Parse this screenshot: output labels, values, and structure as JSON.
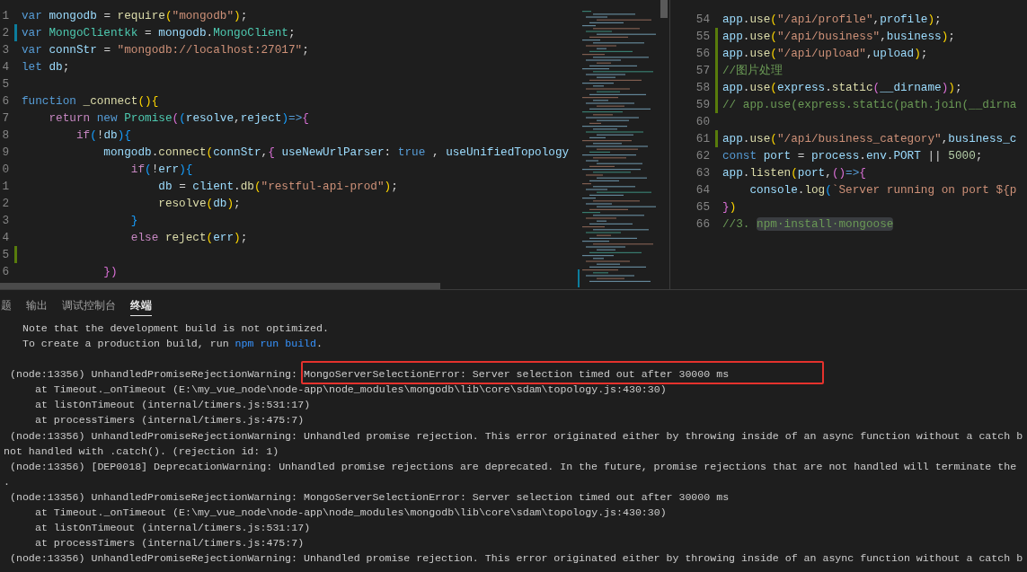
{
  "left_editor": {
    "lines": [
      {
        "number": "1",
        "tokens": [
          {
            "kind": "kw",
            "text": "var"
          },
          {
            "kind": "id",
            "text": " mongodb"
          },
          {
            "kind": "p",
            "text": " = "
          },
          {
            "kind": "fn",
            "text": "require"
          },
          {
            "kind": "b1",
            "text": "("
          },
          {
            "kind": "str",
            "text": "\"mongodb\""
          },
          {
            "kind": "b1",
            "text": ")"
          },
          {
            "kind": "p",
            "text": ";"
          }
        ]
      },
      {
        "number": "2",
        "change_marker": {
          "color": "#0c7d9d"
        },
        "tokens": [
          {
            "kind": "kw",
            "text": "var"
          },
          {
            "kind": "cls",
            "text": " MongoClientkk"
          },
          {
            "kind": "p",
            "text": " = "
          },
          {
            "kind": "id",
            "text": "mongodb"
          },
          {
            "kind": "p",
            "text": "."
          },
          {
            "kind": "cls",
            "text": "MongoClient"
          },
          {
            "kind": "p",
            "text": ";"
          }
        ]
      },
      {
        "number": "3",
        "tokens": [
          {
            "kind": "kw",
            "text": "var"
          },
          {
            "kind": "id",
            "text": " connStr"
          },
          {
            "kind": "p",
            "text": " = "
          },
          {
            "kind": "str",
            "text": "\"mongodb://localhost:27017\""
          },
          {
            "kind": "p",
            "text": ";"
          }
        ]
      },
      {
        "number": "4",
        "tokens": [
          {
            "kind": "kw",
            "text": "let"
          },
          {
            "kind": "id",
            "text": " db"
          },
          {
            "kind": "p",
            "text": ";"
          }
        ]
      },
      {
        "number": "5"
      },
      {
        "number": "6",
        "tokens": [
          {
            "kind": "kw",
            "text": "function"
          },
          {
            "kind": "fn",
            "text": " _connect"
          },
          {
            "kind": "b1",
            "text": "()"
          },
          {
            "kind": "b1",
            "text": "{"
          }
        ]
      },
      {
        "number": "7",
        "tokens": [
          {
            "kind": "ctl",
            "text": "    return"
          },
          {
            "kind": "kw",
            "text": " new"
          },
          {
            "kind": "cls",
            "text": " Promise"
          },
          {
            "kind": "b2",
            "text": "("
          },
          {
            "kind": "b3",
            "text": "("
          },
          {
            "kind": "id",
            "text": "resolve"
          },
          {
            "kind": "p",
            "text": ","
          },
          {
            "kind": "id",
            "text": "reject"
          },
          {
            "kind": "b3",
            "text": ")"
          },
          {
            "kind": "kw",
            "text": "=>"
          },
          {
            "kind": "b2",
            "text": "{"
          }
        ]
      },
      {
        "number": "8",
        "tokens": [
          {
            "kind": "ctl",
            "text": "        if"
          },
          {
            "kind": "b3",
            "text": "("
          },
          {
            "kind": "p",
            "text": "!"
          },
          {
            "kind": "id",
            "text": "db"
          },
          {
            "kind": "b3",
            "text": ")"
          },
          {
            "kind": "b3",
            "text": "{"
          }
        ]
      },
      {
        "number": "9",
        "tokens": [
          {
            "kind": "id",
            "text": "            mongodb"
          },
          {
            "kind": "p",
            "text": "."
          },
          {
            "kind": "fn",
            "text": "connect"
          },
          {
            "kind": "b1",
            "text": "("
          },
          {
            "kind": "id",
            "text": "connStr"
          },
          {
            "kind": "p",
            "text": ","
          },
          {
            "kind": "b2",
            "text": "{"
          },
          {
            "kind": "id",
            "text": " useNewUrlParser"
          },
          {
            "kind": "p",
            "text": ": "
          },
          {
            "kind": "kw",
            "text": "true"
          },
          {
            "kind": "p",
            "text": " , "
          },
          {
            "kind": "id",
            "text": "useUnifiedTopology"
          }
        ]
      },
      {
        "number": "0",
        "tokens": [
          {
            "kind": "ctl",
            "text": "                if"
          },
          {
            "kind": "b3",
            "text": "("
          },
          {
            "kind": "p",
            "text": "!"
          },
          {
            "kind": "id",
            "text": "err"
          },
          {
            "kind": "b3",
            "text": ")"
          },
          {
            "kind": "b3",
            "text": "{"
          }
        ]
      },
      {
        "number": "1",
        "tokens": [
          {
            "kind": "id",
            "text": "                    db"
          },
          {
            "kind": "p",
            "text": " = "
          },
          {
            "kind": "id",
            "text": "client"
          },
          {
            "kind": "p",
            "text": "."
          },
          {
            "kind": "fn",
            "text": "db"
          },
          {
            "kind": "b1",
            "text": "("
          },
          {
            "kind": "str",
            "text": "\"restful-api-prod\""
          },
          {
            "kind": "b1",
            "text": ")"
          },
          {
            "kind": "p",
            "text": ";"
          }
        ]
      },
      {
        "number": "2",
        "tokens": [
          {
            "kind": "fn",
            "text": "                    resolve"
          },
          {
            "kind": "b1",
            "text": "("
          },
          {
            "kind": "id",
            "text": "db"
          },
          {
            "kind": "b1",
            "text": ")"
          },
          {
            "kind": "p",
            "text": ";"
          }
        ]
      },
      {
        "number": "3",
        "tokens": [
          {
            "kind": "b3",
            "text": "                }"
          }
        ]
      },
      {
        "number": "4",
        "tokens": [
          {
            "kind": "ctl",
            "text": "                else"
          },
          {
            "kind": "fn",
            "text": " reject"
          },
          {
            "kind": "b1",
            "text": "("
          },
          {
            "kind": "id",
            "text": "err"
          },
          {
            "kind": "b1",
            "text": ")"
          },
          {
            "kind": "p",
            "text": ";"
          }
        ]
      },
      {
        "number": "5",
        "change_marker": {
          "color": "#587c0c"
        }
      },
      {
        "number": "6",
        "tokens": [
          {
            "kind": "b2",
            "text": "            })"
          }
        ]
      }
    ]
  },
  "right_editor": {
    "lines": [
      {
        "number": "54",
        "tokens": [
          {
            "kind": "id",
            "text": "app"
          },
          {
            "kind": "p",
            "text": "."
          },
          {
            "kind": "fn",
            "text": "use"
          },
          {
            "kind": "b1",
            "text": "("
          },
          {
            "kind": "str",
            "text": "\"/api/profile\""
          },
          {
            "kind": "p",
            "text": ","
          },
          {
            "kind": "id",
            "text": "profile"
          },
          {
            "kind": "b1",
            "text": ")"
          },
          {
            "kind": "p",
            "text": ";"
          }
        ]
      },
      {
        "number": "55",
        "change_marker": {
          "color": "#587c0c"
        },
        "tokens": [
          {
            "kind": "id",
            "text": "app"
          },
          {
            "kind": "p",
            "text": "."
          },
          {
            "kind": "fn",
            "text": "use"
          },
          {
            "kind": "b1",
            "text": "("
          },
          {
            "kind": "str",
            "text": "\"/api/business\""
          },
          {
            "kind": "p",
            "text": ","
          },
          {
            "kind": "id",
            "text": "business"
          },
          {
            "kind": "b1",
            "text": ")"
          },
          {
            "kind": "p",
            "text": ";"
          }
        ]
      },
      {
        "number": "56",
        "change_marker": {
          "color": "#587c0c"
        },
        "tokens": [
          {
            "kind": "id",
            "text": "app"
          },
          {
            "kind": "p",
            "text": "."
          },
          {
            "kind": "fn",
            "text": "use"
          },
          {
            "kind": "b1",
            "text": "("
          },
          {
            "kind": "str",
            "text": "\"/api/upload\""
          },
          {
            "kind": "p",
            "text": ","
          },
          {
            "kind": "id",
            "text": "upload"
          },
          {
            "kind": "b1",
            "text": ")"
          },
          {
            "kind": "p",
            "text": ";"
          }
        ]
      },
      {
        "number": "57",
        "change_marker": {
          "color": "#587c0c"
        },
        "tokens": [
          {
            "kind": "cm",
            "text": "//图片处理"
          }
        ]
      },
      {
        "number": "58",
        "change_marker": {
          "color": "#587c0c"
        },
        "tokens": [
          {
            "kind": "id",
            "text": "app"
          },
          {
            "kind": "p",
            "text": "."
          },
          {
            "kind": "fn",
            "text": "use"
          },
          {
            "kind": "b1",
            "text": "("
          },
          {
            "kind": "id",
            "text": "express"
          },
          {
            "kind": "p",
            "text": "."
          },
          {
            "kind": "fn",
            "text": "static"
          },
          {
            "kind": "b2",
            "text": "("
          },
          {
            "kind": "id",
            "text": "__dirname"
          },
          {
            "kind": "b2",
            "text": ")"
          },
          {
            "kind": "b1",
            "text": ")"
          },
          {
            "kind": "p",
            "text": ";"
          }
        ]
      },
      {
        "number": "59",
        "change_marker": {
          "color": "#587c0c"
        },
        "tokens": [
          {
            "kind": "cm",
            "text": "// app.use(express.static(path.join(__dirna"
          }
        ]
      },
      {
        "number": "60"
      },
      {
        "number": "61",
        "change_marker": {
          "color": "#587c0c"
        },
        "tokens": [
          {
            "kind": "id",
            "text": "app"
          },
          {
            "kind": "p",
            "text": "."
          },
          {
            "kind": "fn",
            "text": "use"
          },
          {
            "kind": "b1",
            "text": "("
          },
          {
            "kind": "str",
            "text": "\"/api/business_category\""
          },
          {
            "kind": "p",
            "text": ","
          },
          {
            "kind": "id",
            "text": "business_c"
          }
        ]
      },
      {
        "number": "62",
        "tokens": [
          {
            "kind": "kw",
            "text": "const"
          },
          {
            "kind": "id",
            "text": " port"
          },
          {
            "kind": "p",
            "text": " = "
          },
          {
            "kind": "id",
            "text": "process"
          },
          {
            "kind": "p",
            "text": "."
          },
          {
            "kind": "id",
            "text": "env"
          },
          {
            "kind": "p",
            "text": "."
          },
          {
            "kind": "id",
            "text": "PORT"
          },
          {
            "kind": "p",
            "text": " || "
          },
          {
            "kind": "num",
            "text": "5000"
          },
          {
            "kind": "p",
            "text": ";"
          }
        ]
      },
      {
        "number": "63",
        "tokens": [
          {
            "kind": "id",
            "text": "app"
          },
          {
            "kind": "p",
            "text": "."
          },
          {
            "kind": "fn",
            "text": "listen"
          },
          {
            "kind": "b1",
            "text": "("
          },
          {
            "kind": "id",
            "text": "port"
          },
          {
            "kind": "p",
            "text": ","
          },
          {
            "kind": "b2",
            "text": "()"
          },
          {
            "kind": "kw",
            "text": "=>"
          },
          {
            "kind": "b2",
            "text": "{"
          }
        ]
      },
      {
        "number": "64",
        "tokens": [
          {
            "kind": "id",
            "text": "    console"
          },
          {
            "kind": "p",
            "text": "."
          },
          {
            "kind": "fn",
            "text": "log"
          },
          {
            "kind": "b3",
            "text": "("
          },
          {
            "kind": "str",
            "text": "`Server running on port ${p"
          }
        ]
      },
      {
        "number": "65",
        "tokens": [
          {
            "kind": "b2",
            "text": "}"
          },
          {
            "kind": "b1",
            "text": ")"
          }
        ]
      },
      {
        "number": "66",
        "tokens": [
          {
            "kind": "cm",
            "text": "//3. "
          },
          {
            "kind": "sel",
            "text": "npm·install·mongoose"
          }
        ]
      }
    ]
  },
  "panel": {
    "tabs": [
      {
        "label": "题",
        "selected": false
      },
      {
        "label": "输出",
        "selected": false
      },
      {
        "label": "调试控制台",
        "selected": false
      },
      {
        "label": "终端",
        "selected": true
      }
    ],
    "terminal_lines": [
      {
        "kind": "note",
        "segments": [
          {
            "kind": "plain",
            "text": "Note that the development build is not optimized."
          }
        ]
      },
      {
        "kind": "note",
        "segments": [
          {
            "kind": "plain",
            "text": "To create a production build, run "
          },
          {
            "kind": "link",
            "text": "npm run build"
          },
          {
            "kind": "plain",
            "text": "."
          }
        ]
      },
      {
        "kind": "blank"
      },
      {
        "kind": "node",
        "segments": [
          {
            "kind": "plain",
            "text": "(node:13356) UnhandledPromiseRejectionWarning: "
          },
          {
            "kind": "boxed",
            "text": "MongoServerSelectionError: Server selection timed out after 30000 ms"
          }
        ]
      },
      {
        "kind": "stack",
        "segments": [
          {
            "kind": "plain",
            "text": "at Timeout._onTimeout (E:\\my_vue_node\\node-app\\node_modules\\mongodb\\lib\\core\\sdam\\topology.js:430:30)"
          }
        ]
      },
      {
        "kind": "stack",
        "segments": [
          {
            "kind": "plain",
            "text": "at listOnTimeout (internal/timers.js:531:17)"
          }
        ]
      },
      {
        "kind": "stack",
        "segments": [
          {
            "kind": "plain",
            "text": "at processTimers (internal/timers.js:475:7)"
          }
        ]
      },
      {
        "kind": "node",
        "segments": [
          {
            "kind": "plain",
            "text": "(node:13356) UnhandledPromiseRejectionWarning: Unhandled promise rejection. This error originated either by throwing inside of an async function without a catch b"
          }
        ]
      },
      {
        "kind": "wrap",
        "segments": [
          {
            "kind": "plain",
            "text": "not handled with .catch(). (rejection id: 1)"
          }
        ]
      },
      {
        "kind": "node",
        "segments": [
          {
            "kind": "plain",
            "text": "(node:13356) [DEP0018] DeprecationWarning: Unhandled promise rejections are deprecated. In the future, promise rejections that are not handled will terminate the"
          }
        ]
      },
      {
        "kind": "wrap",
        "segments": [
          {
            "kind": "plain",
            "text": "."
          }
        ]
      },
      {
        "kind": "node",
        "segments": [
          {
            "kind": "plain",
            "text": "(node:13356) UnhandledPromiseRejectionWarning: MongoServerSelectionError: Server selection timed out after 30000 ms"
          }
        ]
      },
      {
        "kind": "stack",
        "segments": [
          {
            "kind": "plain",
            "text": "at Timeout._onTimeout (E:\\my_vue_node\\node-app\\node_modules\\mongodb\\lib\\core\\sdam\\topology.js:430:30)"
          }
        ]
      },
      {
        "kind": "stack",
        "segments": [
          {
            "kind": "plain",
            "text": "at listOnTimeout (internal/timers.js:531:17)"
          }
        ]
      },
      {
        "kind": "stack",
        "segments": [
          {
            "kind": "plain",
            "text": "at processTimers (internal/timers.js:475:7)"
          }
        ]
      },
      {
        "kind": "node",
        "segments": [
          {
            "kind": "plain",
            "text": "(node:13356) UnhandledPromiseRejectionWarning: Unhandled promise rejection. This error originated either by throwing inside of an async function without a catch b"
          }
        ]
      }
    ]
  }
}
